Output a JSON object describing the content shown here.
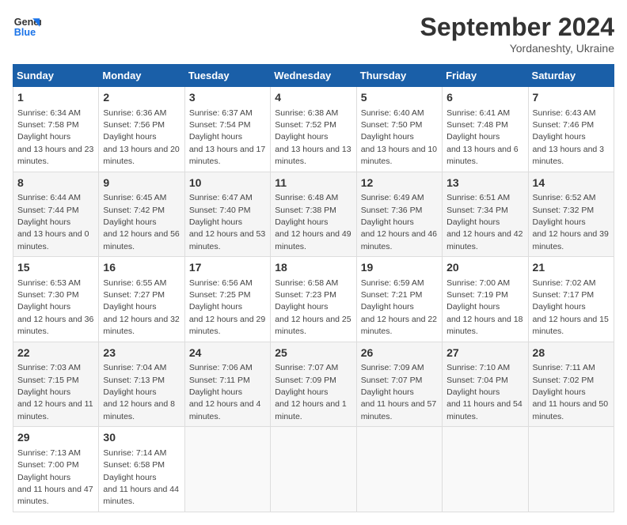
{
  "header": {
    "logo_line1": "General",
    "logo_line2": "Blue",
    "month": "September 2024",
    "location": "Yordaneshty, Ukraine"
  },
  "days_of_week": [
    "Sunday",
    "Monday",
    "Tuesday",
    "Wednesday",
    "Thursday",
    "Friday",
    "Saturday"
  ],
  "weeks": [
    [
      {
        "num": "1",
        "rise": "6:34 AM",
        "set": "7:58 PM",
        "daylight": "13 hours and 23 minutes."
      },
      {
        "num": "2",
        "rise": "6:36 AM",
        "set": "7:56 PM",
        "daylight": "13 hours and 20 minutes."
      },
      {
        "num": "3",
        "rise": "6:37 AM",
        "set": "7:54 PM",
        "daylight": "13 hours and 17 minutes."
      },
      {
        "num": "4",
        "rise": "6:38 AM",
        "set": "7:52 PM",
        "daylight": "13 hours and 13 minutes."
      },
      {
        "num": "5",
        "rise": "6:40 AM",
        "set": "7:50 PM",
        "daylight": "13 hours and 10 minutes."
      },
      {
        "num": "6",
        "rise": "6:41 AM",
        "set": "7:48 PM",
        "daylight": "13 hours and 6 minutes."
      },
      {
        "num": "7",
        "rise": "6:43 AM",
        "set": "7:46 PM",
        "daylight": "13 hours and 3 minutes."
      }
    ],
    [
      {
        "num": "8",
        "rise": "6:44 AM",
        "set": "7:44 PM",
        "daylight": "13 hours and 0 minutes."
      },
      {
        "num": "9",
        "rise": "6:45 AM",
        "set": "7:42 PM",
        "daylight": "12 hours and 56 minutes."
      },
      {
        "num": "10",
        "rise": "6:47 AM",
        "set": "7:40 PM",
        "daylight": "12 hours and 53 minutes."
      },
      {
        "num": "11",
        "rise": "6:48 AM",
        "set": "7:38 PM",
        "daylight": "12 hours and 49 minutes."
      },
      {
        "num": "12",
        "rise": "6:49 AM",
        "set": "7:36 PM",
        "daylight": "12 hours and 46 minutes."
      },
      {
        "num": "13",
        "rise": "6:51 AM",
        "set": "7:34 PM",
        "daylight": "12 hours and 42 minutes."
      },
      {
        "num": "14",
        "rise": "6:52 AM",
        "set": "7:32 PM",
        "daylight": "12 hours and 39 minutes."
      }
    ],
    [
      {
        "num": "15",
        "rise": "6:53 AM",
        "set": "7:30 PM",
        "daylight": "12 hours and 36 minutes."
      },
      {
        "num": "16",
        "rise": "6:55 AM",
        "set": "7:27 PM",
        "daylight": "12 hours and 32 minutes."
      },
      {
        "num": "17",
        "rise": "6:56 AM",
        "set": "7:25 PM",
        "daylight": "12 hours and 29 minutes."
      },
      {
        "num": "18",
        "rise": "6:58 AM",
        "set": "7:23 PM",
        "daylight": "12 hours and 25 minutes."
      },
      {
        "num": "19",
        "rise": "6:59 AM",
        "set": "7:21 PM",
        "daylight": "12 hours and 22 minutes."
      },
      {
        "num": "20",
        "rise": "7:00 AM",
        "set": "7:19 PM",
        "daylight": "12 hours and 18 minutes."
      },
      {
        "num": "21",
        "rise": "7:02 AM",
        "set": "7:17 PM",
        "daylight": "12 hours and 15 minutes."
      }
    ],
    [
      {
        "num": "22",
        "rise": "7:03 AM",
        "set": "7:15 PM",
        "daylight": "12 hours and 11 minutes."
      },
      {
        "num": "23",
        "rise": "7:04 AM",
        "set": "7:13 PM",
        "daylight": "12 hours and 8 minutes."
      },
      {
        "num": "24",
        "rise": "7:06 AM",
        "set": "7:11 PM",
        "daylight": "12 hours and 4 minutes."
      },
      {
        "num": "25",
        "rise": "7:07 AM",
        "set": "7:09 PM",
        "daylight": "12 hours and 1 minute."
      },
      {
        "num": "26",
        "rise": "7:09 AM",
        "set": "7:07 PM",
        "daylight": "11 hours and 57 minutes."
      },
      {
        "num": "27",
        "rise": "7:10 AM",
        "set": "7:04 PM",
        "daylight": "11 hours and 54 minutes."
      },
      {
        "num": "28",
        "rise": "7:11 AM",
        "set": "7:02 PM",
        "daylight": "11 hours and 50 minutes."
      }
    ],
    [
      {
        "num": "29",
        "rise": "7:13 AM",
        "set": "7:00 PM",
        "daylight": "11 hours and 47 minutes."
      },
      {
        "num": "30",
        "rise": "7:14 AM",
        "set": "6:58 PM",
        "daylight": "11 hours and 44 minutes."
      },
      null,
      null,
      null,
      null,
      null
    ]
  ]
}
